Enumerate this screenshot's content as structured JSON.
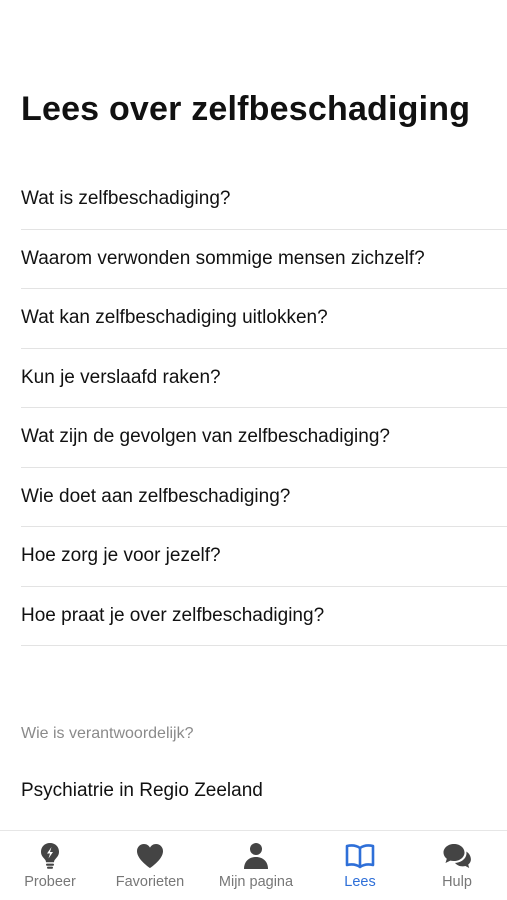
{
  "page": {
    "title": "Lees over zelfbeschadiging"
  },
  "topics": [
    {
      "label": "Wat is zelfbeschadiging?"
    },
    {
      "label": "Waarom verwonden sommige mensen zichzelf?"
    },
    {
      "label": "Wat kan zelfbeschadiging uitlokken?"
    },
    {
      "label": "Kun je verslaafd raken?"
    },
    {
      "label": "Wat zijn de gevolgen van zelfbeschadiging?"
    },
    {
      "label": "Wie doet aan zelfbeschadiging?"
    },
    {
      "label": "Hoe zorg je voor jezelf?"
    },
    {
      "label": "Hoe praat je over zelfbeschadiging?"
    }
  ],
  "responsible": {
    "caption": "Wie is verantwoordelijk?",
    "name": "Psychiatrie in Regio Zeeland"
  },
  "tabbar": {
    "tabs": [
      {
        "label": "Probeer",
        "icon": "lightbulb-icon",
        "active": false
      },
      {
        "label": "Favorieten",
        "icon": "heart-icon",
        "active": false
      },
      {
        "label": "Mijn pagina",
        "icon": "person-icon",
        "active": false
      },
      {
        "label": "Lees",
        "icon": "book-icon",
        "active": true
      },
      {
        "label": "Hulp",
        "icon": "chat-bubbles-icon",
        "active": false
      }
    ]
  },
  "colors": {
    "text": "#111111",
    "caption": "#8a8a8a",
    "divider": "#e3e3e3",
    "tab_inactive": "#444444",
    "tab_active": "#2e6fd8"
  }
}
